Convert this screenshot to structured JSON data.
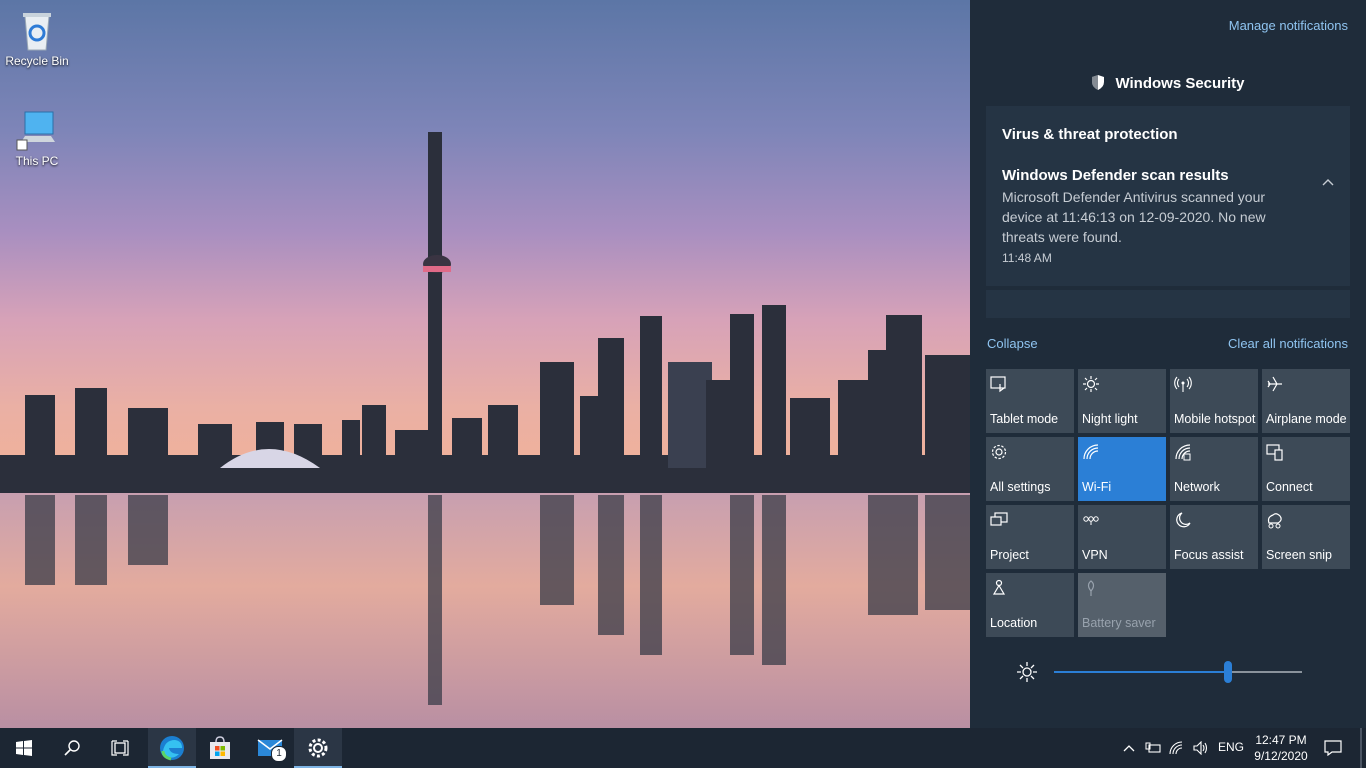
{
  "desktop": {
    "icons": [
      {
        "label": "Recycle Bin",
        "icon": "recycle-bin-icon"
      },
      {
        "label": "This PC",
        "icon": "computer-icon"
      }
    ]
  },
  "action_center": {
    "manage_notifications": "Manage notifications",
    "app_title": "Windows Security",
    "app_icon": "shield-icon",
    "notification": {
      "group": "Virus & threat protection",
      "title": "Windows Defender scan results",
      "body": "Microsoft Defender Antivirus scanned your device at 11:46:13 on 12-09-2020. No new threats were found.",
      "time": "11:48 AM"
    },
    "collapse": "Collapse",
    "clear_all": "Clear all notifications",
    "tiles": [
      {
        "label": "Tablet mode",
        "icon": "tablet-mode-icon",
        "state": "off"
      },
      {
        "label": "Night light",
        "icon": "night-light-icon",
        "state": "off"
      },
      {
        "label": "Mobile hotspot",
        "icon": "mobile-hotspot-icon",
        "state": "off"
      },
      {
        "label": "Airplane mode",
        "icon": "airplane-icon",
        "state": "off"
      },
      {
        "label": "All settings",
        "icon": "gear-icon",
        "state": "off"
      },
      {
        "label": "Wi-Fi",
        "icon": "wifi-icon",
        "state": "on"
      },
      {
        "label": "Network",
        "icon": "network-icon",
        "state": "off"
      },
      {
        "label": "Connect",
        "icon": "connect-icon",
        "state": "off"
      },
      {
        "label": "Project",
        "icon": "project-icon",
        "state": "off"
      },
      {
        "label": "VPN",
        "icon": "vpn-icon",
        "state": "off"
      },
      {
        "label": "Focus assist",
        "icon": "moon-icon",
        "state": "off"
      },
      {
        "label": "Screen snip",
        "icon": "screen-snip-icon",
        "state": "off"
      },
      {
        "label": "Location",
        "icon": "location-icon",
        "state": "off"
      },
      {
        "label": "Battery saver",
        "icon": "battery-saver-icon",
        "state": "disabled"
      }
    ],
    "brightness_percent": 70
  },
  "taskbar": {
    "apps": [
      {
        "name": "start",
        "icon": "windows-logo-icon"
      },
      {
        "name": "search",
        "icon": "search-icon"
      },
      {
        "name": "task-view",
        "icon": "task-view-icon"
      },
      {
        "name": "edge",
        "icon": "edge-icon",
        "active": true
      },
      {
        "name": "store",
        "icon": "store-icon"
      },
      {
        "name": "mail",
        "icon": "mail-icon",
        "badge": "1"
      },
      {
        "name": "settings",
        "icon": "gear-icon",
        "active": true
      }
    ],
    "tray": {
      "language": "ENG",
      "time": "12:47 PM",
      "date": "9/12/2020"
    }
  },
  "colors": {
    "accent": "#2b7fd6",
    "panel": "#1f2c3a",
    "link": "#8fc4f0"
  }
}
